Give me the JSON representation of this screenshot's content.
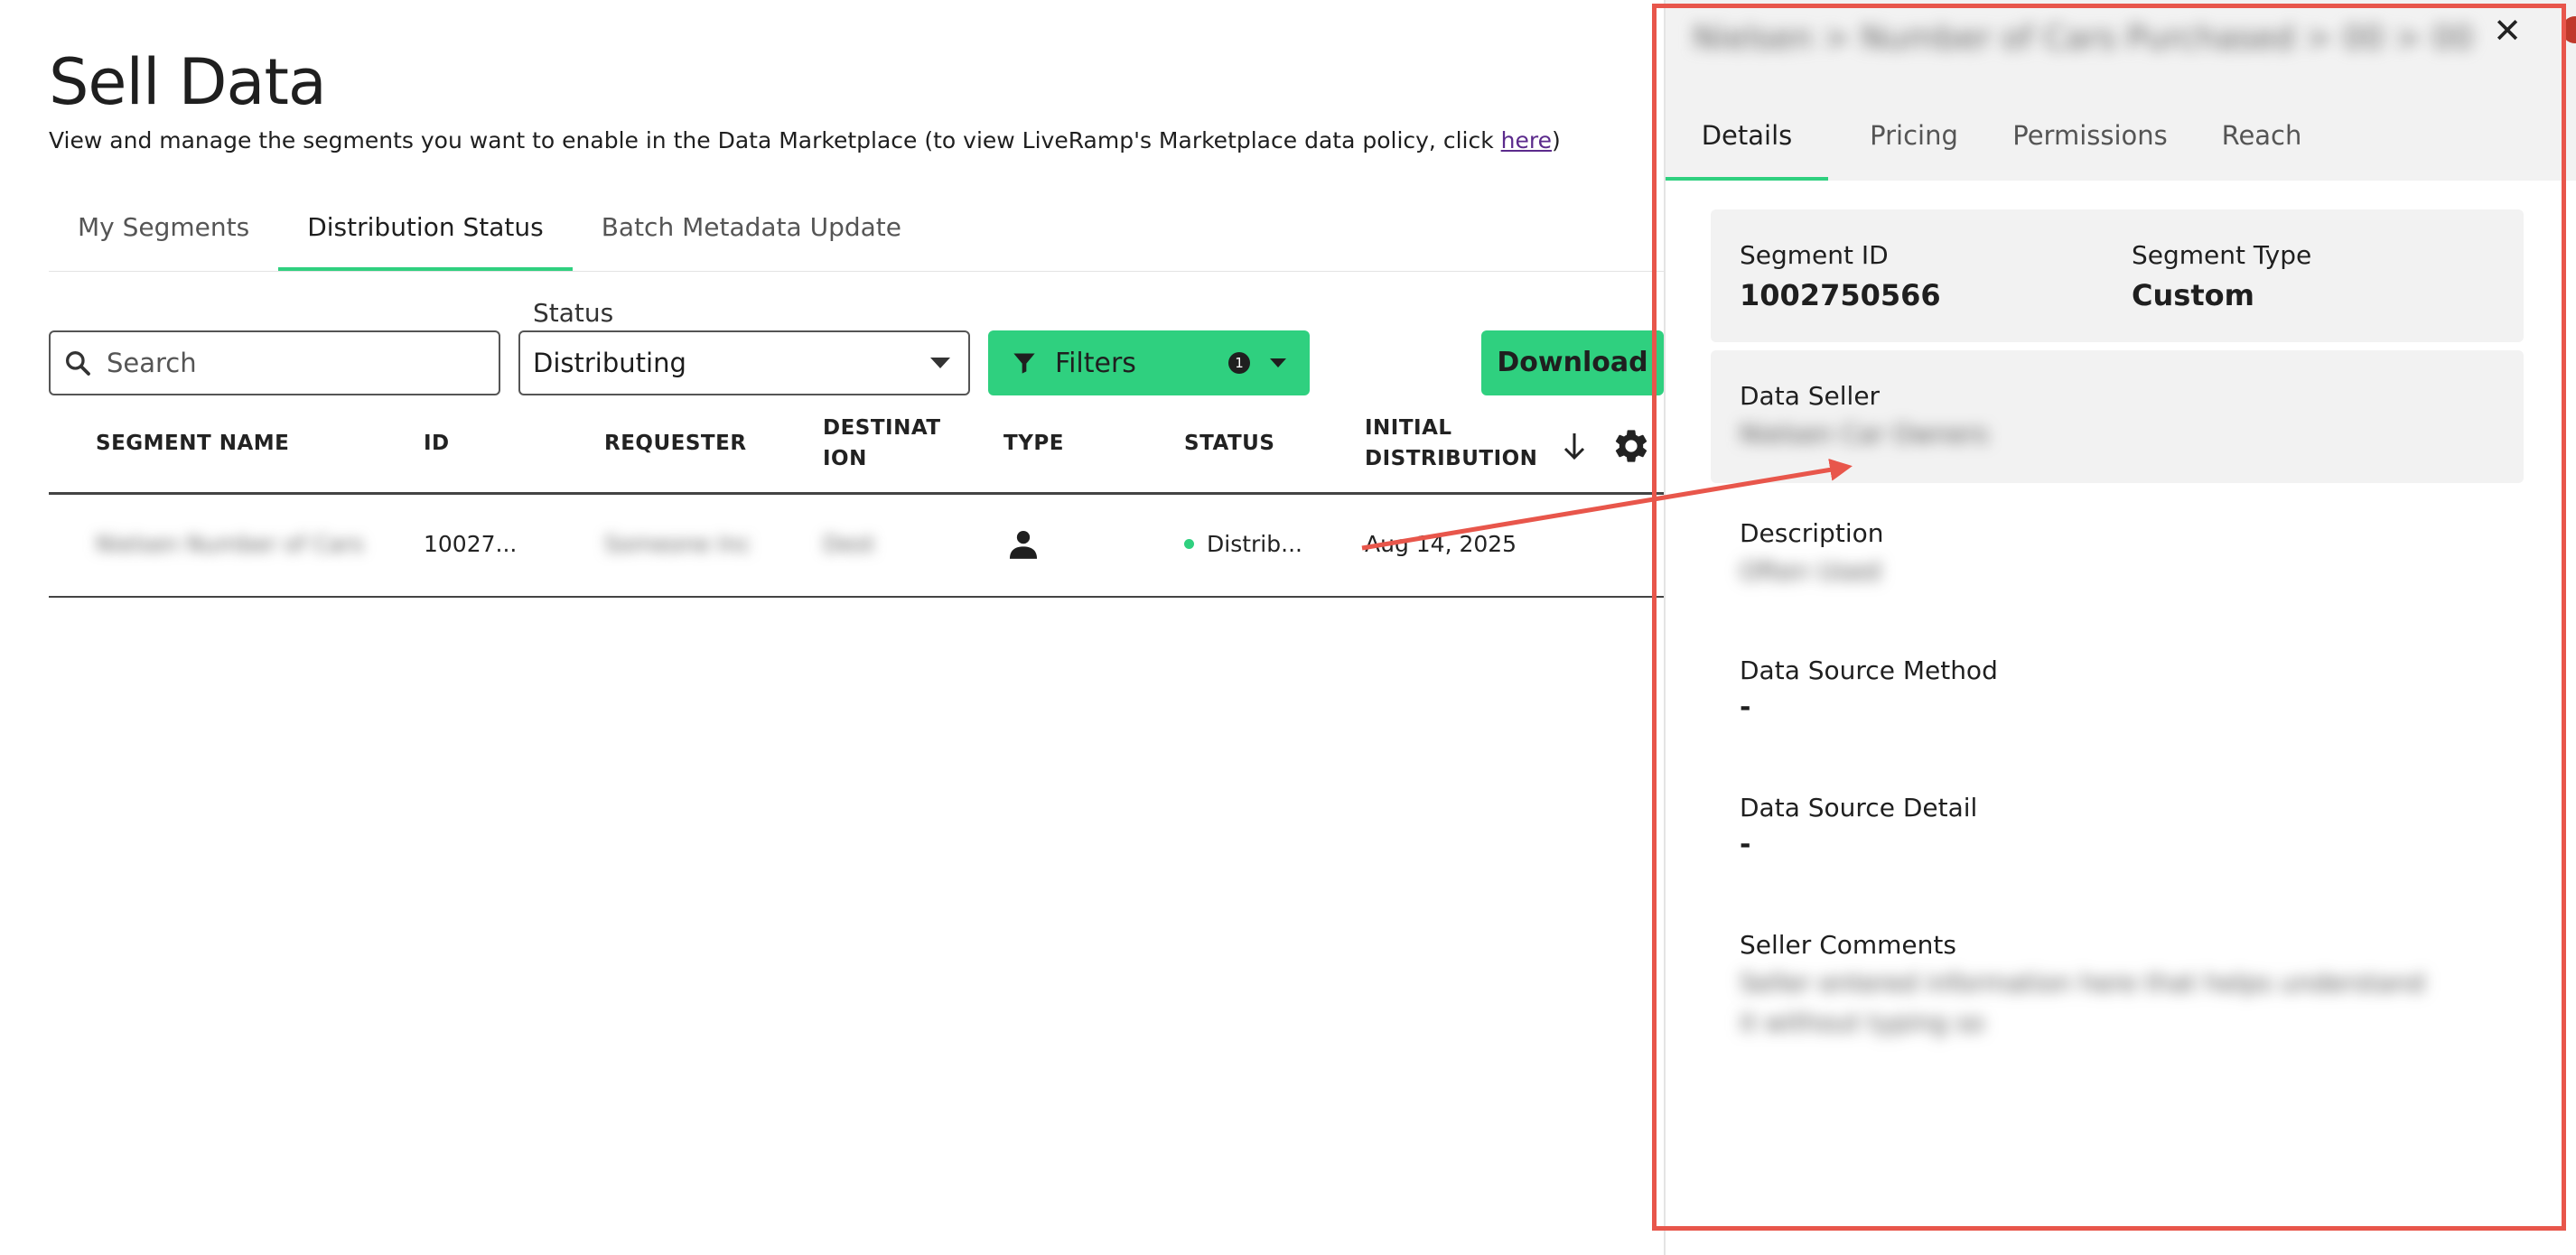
{
  "page": {
    "title": "Sell Data",
    "subtitle": "View and manage the segments you want to enable in the Data Marketplace (to view LiveRamp's Marketplace data policy, click ",
    "subtitle_link": "here",
    "subtitle_end": ")"
  },
  "tabs": [
    "My Segments",
    "Distribution Status",
    "Batch Metadata Update"
  ],
  "toolbar": {
    "search_placeholder": "Search",
    "status_label": "Status",
    "status_value": "Distributing",
    "filters_label": "Filters",
    "filters_count": "1",
    "download_label": "Download"
  },
  "table": {
    "headers": {
      "segment_name": "SEGMENT NAME",
      "id": "ID",
      "requester": "REQUESTER",
      "destination_1": "DESTINAT",
      "destination_2": "ION",
      "type": "TYPE",
      "status": "STATUS",
      "initial_distribution_1": "INITIAL",
      "initial_distribution_2": "DISTRIBUTION"
    },
    "rows": [
      {
        "segment_name": "Nielsen Number of Cars",
        "id": "10027...",
        "requester": "Someone Inc",
        "destination": "Dest",
        "type_icon": "person-icon",
        "status": "Distrib...",
        "initial_distribution": "Aug 14, 2025"
      }
    ]
  },
  "panel": {
    "title": "Nielsen > Number of Cars Purchased > 00 > 00",
    "tabs": [
      "Details",
      "Pricing",
      "Permissions",
      "Reach"
    ],
    "segment_id_label": "Segment ID",
    "segment_id_value": "1002750566",
    "segment_type_label": "Segment Type",
    "segment_type_value": "Custom",
    "data_seller_label": "Data Seller",
    "data_seller_value": "Nielsen Car Owners",
    "description_label": "Description",
    "description_value": "Often Used",
    "data_source_method_label": "Data Source Method",
    "data_source_method_value": "-",
    "data_source_detail_label": "Data Source Detail",
    "data_source_detail_value": "-",
    "seller_comments_label": "Seller Comments",
    "seller_comments_line1": "Seller entered information here that helps understand",
    "seller_comments_line2": "it without typing so"
  },
  "colors": {
    "accent": "#2fd07f",
    "annotation": "#e8564b",
    "link": "#5b2a8c"
  }
}
